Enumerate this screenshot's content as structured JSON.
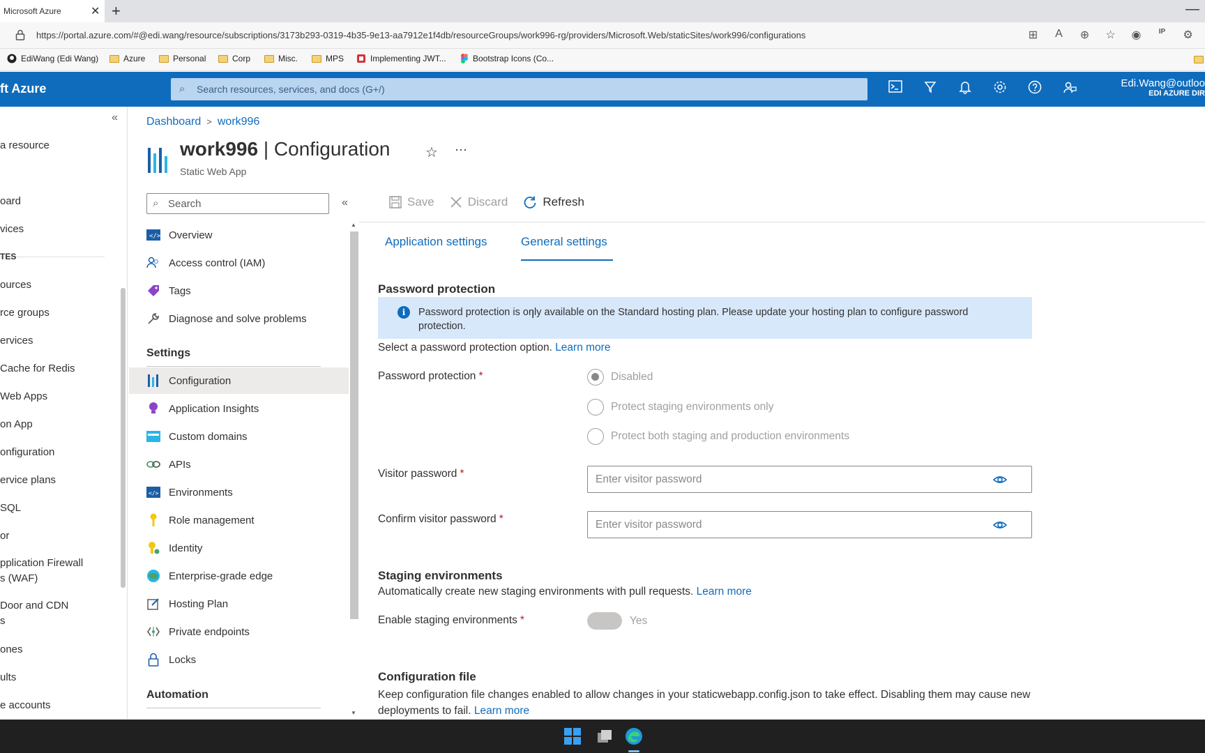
{
  "browser": {
    "tab_title": "Microsoft Azure",
    "tab_close": "✕",
    "new_tab": "+",
    "minimize": "—",
    "url": "https://portal.azure.com/#@edi.wang/resource/subscriptions/3173b293-0319-4b35-9e13-aa7912e1f4db/resourceGroups/work996-rg/providers/Microsoft.Web/staticSites/work996/configurations",
    "address_icons": [
      "⊞",
      "A",
      "⊕",
      "☆",
      "◉",
      "IP",
      "⚙"
    ],
    "bookmarks": [
      {
        "label": "EdiWang (Edi Wang)",
        "icon": "github-icon"
      },
      {
        "label": "Azure",
        "icon": "folder-icon"
      },
      {
        "label": "Personal",
        "icon": "folder-icon"
      },
      {
        "label": "Corp",
        "icon": "folder-icon"
      },
      {
        "label": "Misc.",
        "icon": "folder-icon"
      },
      {
        "label": "MPS",
        "icon": "folder-icon"
      },
      {
        "label": "Implementing JWT...",
        "icon": "bookmark-red-icon"
      },
      {
        "label": "Bootstrap Icons (Co...",
        "icon": "figma-icon"
      }
    ]
  },
  "azure_header": {
    "brand": "ft Azure",
    "search_placeholder": "Search resources, services, and docs (G+/)",
    "user_email": "Edi.Wang@outloo",
    "user_directory": "EDI AZURE DIR",
    "colors": {
      "header_bg": "#0f6cbd",
      "search_bg": "#b9d5f0"
    }
  },
  "left_nav": {
    "collapse": "«",
    "items": [
      {
        "label": "a resource"
      },
      {
        "label": "oard"
      },
      {
        "label": "vices"
      },
      {
        "label": "TES",
        "heading": true
      },
      {
        "label": "ources"
      },
      {
        "label": "rce groups"
      },
      {
        "label": "ervices"
      },
      {
        "label": "Cache for Redis"
      },
      {
        "label": "Web Apps"
      },
      {
        "label": "on App"
      },
      {
        "label": "onfiguration"
      },
      {
        "label": "ervice plans"
      },
      {
        "label": "SQL"
      },
      {
        "label": "or"
      },
      {
        "label": "pplication Firewall"
      },
      {
        "label": "s (WAF)"
      },
      {
        "label": "Door and CDN"
      },
      {
        "label": "s"
      },
      {
        "label": "ones"
      },
      {
        "label": "ults"
      },
      {
        "label": "e accounts"
      }
    ]
  },
  "breadcrumb": {
    "items": [
      "Dashboard",
      "work996"
    ],
    "separator": ">"
  },
  "resource": {
    "name": "work996",
    "separator": " | ",
    "page": "Configuration",
    "type": "Static Web App",
    "favorite": "☆",
    "more": "···"
  },
  "resource_menu": {
    "search_placeholder": "Search",
    "collapse": "«",
    "items": [
      {
        "label": "Overview",
        "icon": "overview-icon"
      },
      {
        "label": "Access control (IAM)",
        "icon": "people-icon"
      },
      {
        "label": "Tags",
        "icon": "tag-icon"
      },
      {
        "label": "Diagnose and solve problems",
        "icon": "wrench-icon"
      }
    ],
    "settings_heading": "Settings",
    "settings_items": [
      {
        "label": "Configuration",
        "icon": "configuration-icon",
        "active": true
      },
      {
        "label": "Application Insights",
        "icon": "lightbulb-icon"
      },
      {
        "label": "Custom domains",
        "icon": "domain-icon"
      },
      {
        "label": "APIs",
        "icon": "link-icon"
      },
      {
        "label": "Environments",
        "icon": "environment-icon"
      },
      {
        "label": "Role management",
        "icon": "key-icon"
      },
      {
        "label": "Identity",
        "icon": "identity-icon"
      },
      {
        "label": "Enterprise-grade edge",
        "icon": "globe-icon"
      },
      {
        "label": "Hosting Plan",
        "icon": "edit-icon"
      },
      {
        "label": "Private endpoints",
        "icon": "endpoint-icon"
      },
      {
        "label": "Locks",
        "icon": "lock-icon"
      }
    ],
    "automation_heading": "Automation"
  },
  "toolbar": {
    "save": "Save",
    "discard": "Discard",
    "refresh": "Refresh"
  },
  "tabs": [
    {
      "label": "Application settings",
      "active": false
    },
    {
      "label": "General settings",
      "active": true
    }
  ],
  "password_protection": {
    "title": "Password protection",
    "info": "Password protection is only available on the Standard hosting plan. Please update your hosting plan to configure password protection.",
    "select_text": "Select a password protection option.",
    "learn_more": "Learn more",
    "field_label": "Password protection",
    "required_mark": "*",
    "options": [
      {
        "label": "Disabled",
        "selected": true
      },
      {
        "label": "Protect staging environments only",
        "selected": false
      },
      {
        "label": "Protect both staging and production environments",
        "selected": false
      }
    ],
    "visitor_password_label": "Visitor password",
    "visitor_password_placeholder": "Enter visitor password",
    "visitor_password_value": "",
    "confirm_password_label": "Confirm visitor password",
    "confirm_password_placeholder": "Enter visitor password",
    "confirm_password_value": ""
  },
  "staging": {
    "title": "Staging environments",
    "desc": "Automatically create new staging environments with pull requests.",
    "learn_more": "Learn more",
    "field_label": "Enable staging environments",
    "required_mark": "*",
    "toggle_label": "Yes",
    "enabled": true
  },
  "config_file": {
    "title": "Configuration file",
    "desc": "Keep configuration file changes enabled to allow changes in your staticwebapp.config.json to take effect. Disabling them may cause new deployments to fail.",
    "learn_more": "Learn more"
  }
}
